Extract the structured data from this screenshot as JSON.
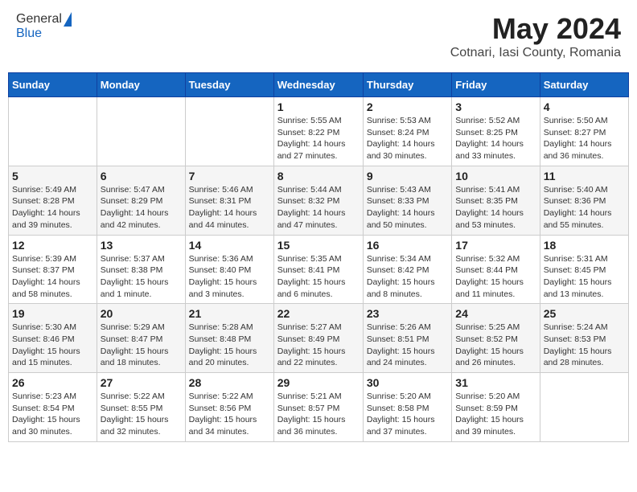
{
  "logo": {
    "general": "General",
    "blue": "Blue"
  },
  "title": {
    "month_year": "May 2024",
    "location": "Cotnari, Iasi County, Romania"
  },
  "weekdays": [
    "Sunday",
    "Monday",
    "Tuesday",
    "Wednesday",
    "Thursday",
    "Friday",
    "Saturday"
  ],
  "weeks": [
    [
      {
        "day": null,
        "info": null
      },
      {
        "day": null,
        "info": null
      },
      {
        "day": null,
        "info": null
      },
      {
        "day": "1",
        "info": "Sunrise: 5:55 AM\nSunset: 8:22 PM\nDaylight: 14 hours and 27 minutes."
      },
      {
        "day": "2",
        "info": "Sunrise: 5:53 AM\nSunset: 8:24 PM\nDaylight: 14 hours and 30 minutes."
      },
      {
        "day": "3",
        "info": "Sunrise: 5:52 AM\nSunset: 8:25 PM\nDaylight: 14 hours and 33 minutes."
      },
      {
        "day": "4",
        "info": "Sunrise: 5:50 AM\nSunset: 8:27 PM\nDaylight: 14 hours and 36 minutes."
      }
    ],
    [
      {
        "day": "5",
        "info": "Sunrise: 5:49 AM\nSunset: 8:28 PM\nDaylight: 14 hours and 39 minutes."
      },
      {
        "day": "6",
        "info": "Sunrise: 5:47 AM\nSunset: 8:29 PM\nDaylight: 14 hours and 42 minutes."
      },
      {
        "day": "7",
        "info": "Sunrise: 5:46 AM\nSunset: 8:31 PM\nDaylight: 14 hours and 44 minutes."
      },
      {
        "day": "8",
        "info": "Sunrise: 5:44 AM\nSunset: 8:32 PM\nDaylight: 14 hours and 47 minutes."
      },
      {
        "day": "9",
        "info": "Sunrise: 5:43 AM\nSunset: 8:33 PM\nDaylight: 14 hours and 50 minutes."
      },
      {
        "day": "10",
        "info": "Sunrise: 5:41 AM\nSunset: 8:35 PM\nDaylight: 14 hours and 53 minutes."
      },
      {
        "day": "11",
        "info": "Sunrise: 5:40 AM\nSunset: 8:36 PM\nDaylight: 14 hours and 55 minutes."
      }
    ],
    [
      {
        "day": "12",
        "info": "Sunrise: 5:39 AM\nSunset: 8:37 PM\nDaylight: 14 hours and 58 minutes."
      },
      {
        "day": "13",
        "info": "Sunrise: 5:37 AM\nSunset: 8:38 PM\nDaylight: 15 hours and 1 minute."
      },
      {
        "day": "14",
        "info": "Sunrise: 5:36 AM\nSunset: 8:40 PM\nDaylight: 15 hours and 3 minutes."
      },
      {
        "day": "15",
        "info": "Sunrise: 5:35 AM\nSunset: 8:41 PM\nDaylight: 15 hours and 6 minutes."
      },
      {
        "day": "16",
        "info": "Sunrise: 5:34 AM\nSunset: 8:42 PM\nDaylight: 15 hours and 8 minutes."
      },
      {
        "day": "17",
        "info": "Sunrise: 5:32 AM\nSunset: 8:44 PM\nDaylight: 15 hours and 11 minutes."
      },
      {
        "day": "18",
        "info": "Sunrise: 5:31 AM\nSunset: 8:45 PM\nDaylight: 15 hours and 13 minutes."
      }
    ],
    [
      {
        "day": "19",
        "info": "Sunrise: 5:30 AM\nSunset: 8:46 PM\nDaylight: 15 hours and 15 minutes."
      },
      {
        "day": "20",
        "info": "Sunrise: 5:29 AM\nSunset: 8:47 PM\nDaylight: 15 hours and 18 minutes."
      },
      {
        "day": "21",
        "info": "Sunrise: 5:28 AM\nSunset: 8:48 PM\nDaylight: 15 hours and 20 minutes."
      },
      {
        "day": "22",
        "info": "Sunrise: 5:27 AM\nSunset: 8:49 PM\nDaylight: 15 hours and 22 minutes."
      },
      {
        "day": "23",
        "info": "Sunrise: 5:26 AM\nSunset: 8:51 PM\nDaylight: 15 hours and 24 minutes."
      },
      {
        "day": "24",
        "info": "Sunrise: 5:25 AM\nSunset: 8:52 PM\nDaylight: 15 hours and 26 minutes."
      },
      {
        "day": "25",
        "info": "Sunrise: 5:24 AM\nSunset: 8:53 PM\nDaylight: 15 hours and 28 minutes."
      }
    ],
    [
      {
        "day": "26",
        "info": "Sunrise: 5:23 AM\nSunset: 8:54 PM\nDaylight: 15 hours and 30 minutes."
      },
      {
        "day": "27",
        "info": "Sunrise: 5:22 AM\nSunset: 8:55 PM\nDaylight: 15 hours and 32 minutes."
      },
      {
        "day": "28",
        "info": "Sunrise: 5:22 AM\nSunset: 8:56 PM\nDaylight: 15 hours and 34 minutes."
      },
      {
        "day": "29",
        "info": "Sunrise: 5:21 AM\nSunset: 8:57 PM\nDaylight: 15 hours and 36 minutes."
      },
      {
        "day": "30",
        "info": "Sunrise: 5:20 AM\nSunset: 8:58 PM\nDaylight: 15 hours and 37 minutes."
      },
      {
        "day": "31",
        "info": "Sunrise: 5:20 AM\nSunset: 8:59 PM\nDaylight: 15 hours and 39 minutes."
      },
      {
        "day": null,
        "info": null
      }
    ]
  ]
}
